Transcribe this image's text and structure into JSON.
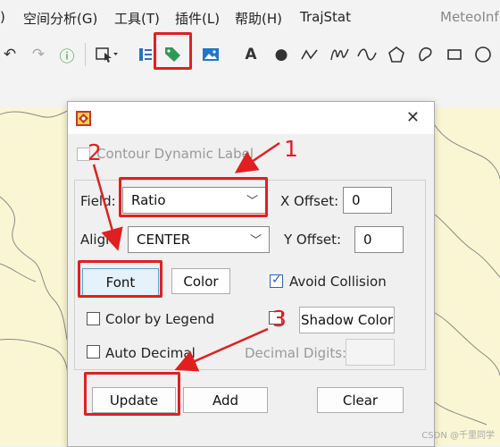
{
  "menu": {
    "items": [
      ")",
      "空间分析(G)",
      "工具(T)",
      "插件(L)",
      "帮助(H)",
      "TrajStat"
    ],
    "brand": "MeteoInf"
  },
  "toolbar": {
    "icons": [
      "undo-icon",
      "redo-icon",
      "info-icon",
      "select-icon",
      "legend-icon",
      "label-icon",
      "image-icon",
      "text-icon",
      "point-icon",
      "polyline-icon",
      "freehand-icon",
      "curve-icon",
      "polygon-icon",
      "curve-polygon-icon",
      "rectangle-icon",
      "circle-icon"
    ]
  },
  "dialog": {
    "contour_dynamic_label": "Contour Dynamic Label",
    "field_label": "Field:",
    "field_value": "Ratio",
    "x_offset_label": "X Offset:",
    "x_offset_value": "0",
    "align_label": "Align:",
    "align_value": "CENTER",
    "y_offset_label": "Y Offset:",
    "y_offset_value": "0",
    "font_button": "Font",
    "color_button": "Color",
    "avoid_collision_label": "Avoid Collision",
    "avoid_collision_checked": true,
    "color_by_legend_label": "Color by Legend",
    "shadow_color_button": "Shadow Color",
    "auto_decimal_label": "Auto Decimal",
    "decimal_digits_label": "Decimal Digits:",
    "decimal_digits_value": "",
    "update_button": "Update",
    "add_button": "Add",
    "clear_button": "Clear",
    "close_glyph": "✕"
  },
  "annotations": {
    "n1": "1",
    "n2": "2",
    "n3": "3",
    "color": "#e02020"
  },
  "watermark": "CSDN @千里同学"
}
